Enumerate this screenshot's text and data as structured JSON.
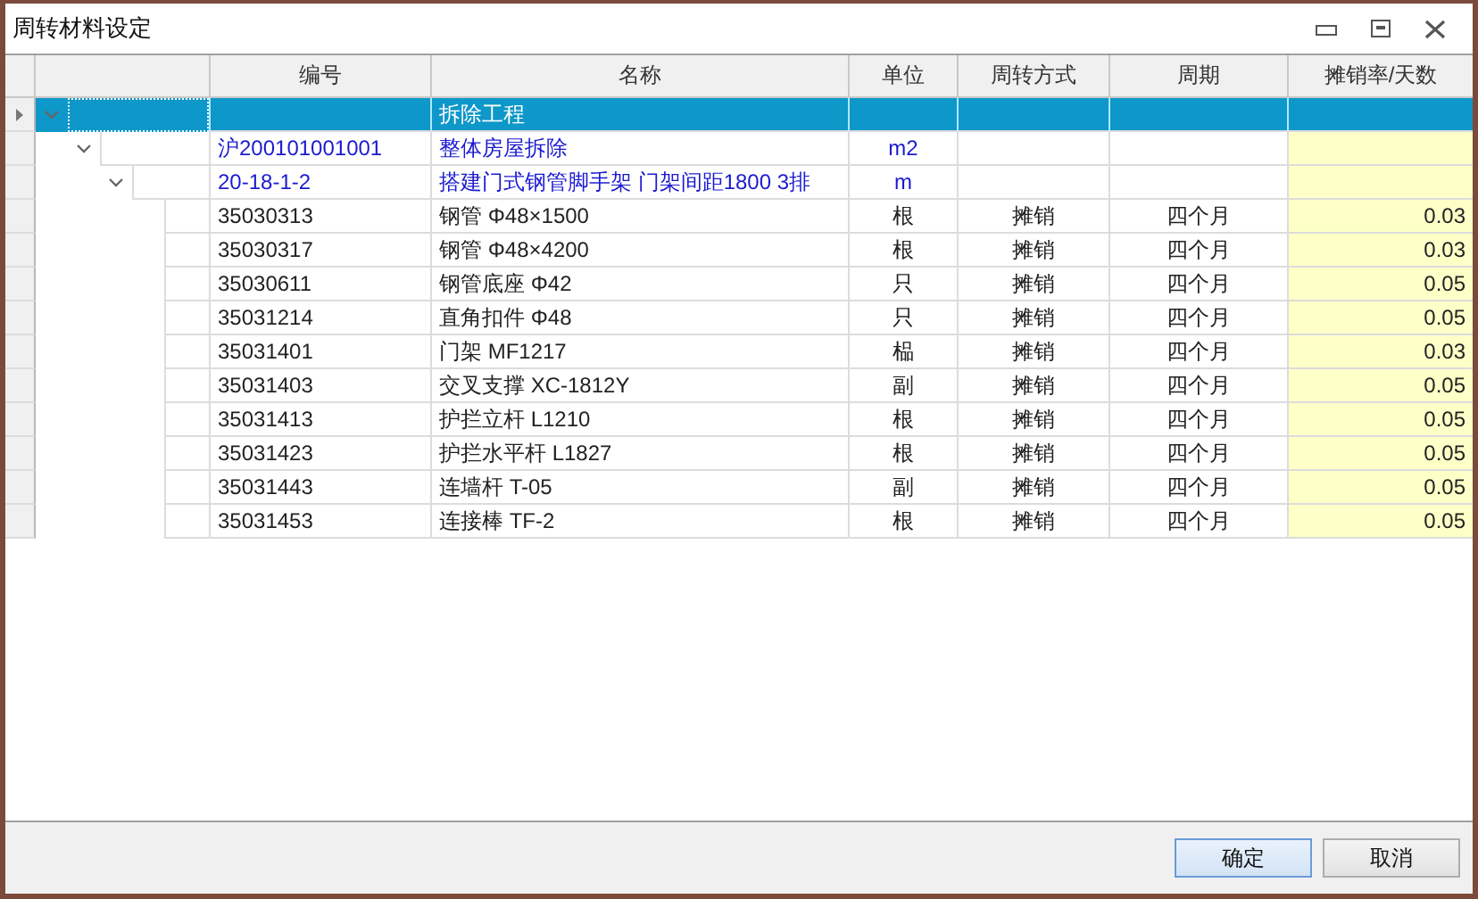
{
  "window": {
    "title": "周转材料设定"
  },
  "columns": [
    "编号",
    "名称",
    "单位",
    "周转方式",
    "周期",
    "摊销率/天数"
  ],
  "tree": [
    {
      "name": "拆除工程",
      "selected": true,
      "expanded": true,
      "children": [
        {
          "code": "沪200101001001",
          "name": "整体房屋拆除",
          "unit": "m2",
          "selected": false,
          "expanded": true,
          "children": [
            {
              "code": "20-18-1-2",
              "name": "搭建门式钢管脚手架 门架间距1800 3排",
              "unit": "m",
              "selected": false,
              "expanded": true,
              "children": [
                {
                  "code": "35030313",
                  "name": "钢管 Φ48×1500",
                  "unit": "根",
                  "method": "摊销",
                  "period": "四个月",
                  "rate": "0.03",
                  "selected": false
                },
                {
                  "code": "35030317",
                  "name": "钢管 Φ48×4200",
                  "unit": "根",
                  "method": "摊销",
                  "period": "四个月",
                  "rate": "0.03",
                  "selected": false
                },
                {
                  "code": "35030611",
                  "name": "钢管底座 Φ42",
                  "unit": "只",
                  "method": "摊销",
                  "period": "四个月",
                  "rate": "0.05",
                  "selected": false
                },
                {
                  "code": "35031214",
                  "name": "直角扣件 Φ48",
                  "unit": "只",
                  "method": "摊销",
                  "period": "四个月",
                  "rate": "0.05",
                  "selected": false
                },
                {
                  "code": "35031401",
                  "name": "门架 MF1217",
                  "unit": "榀",
                  "method": "摊销",
                  "period": "四个月",
                  "rate": "0.03",
                  "selected": false
                },
                {
                  "code": "35031403",
                  "name": "交叉支撑 XC-1812Y",
                  "unit": "副",
                  "method": "摊销",
                  "period": "四个月",
                  "rate": "0.05",
                  "selected": false
                },
                {
                  "code": "35031413",
                  "name": "护拦立杆 L1210",
                  "unit": "根",
                  "method": "摊销",
                  "period": "四个月",
                  "rate": "0.05",
                  "selected": false
                },
                {
                  "code": "35031423",
                  "name": "护拦水平杆 L1827",
                  "unit": "根",
                  "method": "摊销",
                  "period": "四个月",
                  "rate": "0.05",
                  "selected": false
                },
                {
                  "code": "35031443",
                  "name": "连墙杆 T-05",
                  "unit": "副",
                  "method": "摊销",
                  "period": "四个月",
                  "rate": "0.05",
                  "selected": false
                },
                {
                  "code": "35031453",
                  "name": "连接棒 TF-2",
                  "unit": "根",
                  "method": "摊销",
                  "period": "四个月",
                  "rate": "0.05",
                  "selected": false
                }
              ]
            }
          ]
        }
      ]
    }
  ],
  "buttons": [
    "确定",
    "取消"
  ]
}
